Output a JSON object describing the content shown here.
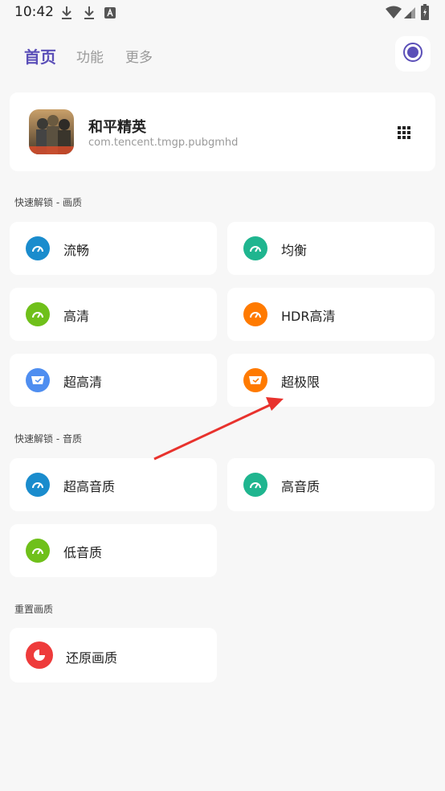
{
  "status": {
    "time": "10:42"
  },
  "tabs": [
    {
      "label": "首页"
    },
    {
      "label": "功能"
    },
    {
      "label": "更多"
    }
  ],
  "app": {
    "name": "和平精英",
    "package": "com.tencent.tmgp.pubgmhd"
  },
  "sections": {
    "quality": "快速解锁 - 画质",
    "audio": "快速解锁 - 音质",
    "reset": "重置画质"
  },
  "quality_items": [
    {
      "label": "流畅",
      "color": "#1a8ccd"
    },
    {
      "label": "均衡",
      "color": "#1fb58f"
    },
    {
      "label": "高清",
      "color": "#6fc01a"
    },
    {
      "label": "HDR高清",
      "color": "#ff7a00"
    },
    {
      "label": "超高清",
      "color": "#4f8ef0"
    },
    {
      "label": "超极限",
      "color": "#ff7a00"
    }
  ],
  "audio_items": [
    {
      "label": "超高音质",
      "color": "#1a8ccd"
    },
    {
      "label": "高音质",
      "color": "#1fb58f"
    },
    {
      "label": "低音质",
      "color": "#6fc01a"
    }
  ],
  "reset_item": {
    "label": "还原画质",
    "color": "#ee3b3b"
  },
  "accent_color": "#5b4fb8"
}
